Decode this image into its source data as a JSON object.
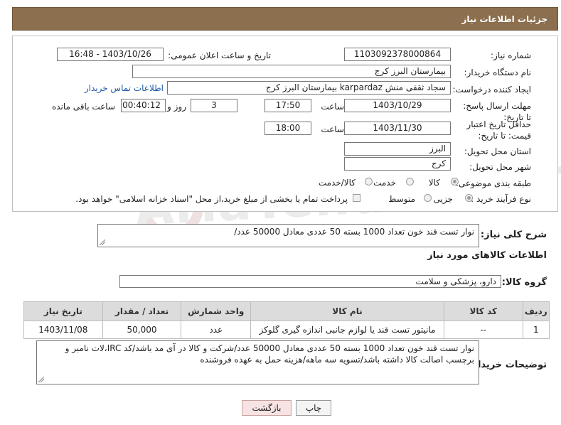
{
  "header": {
    "title": "جزئیات اطلاعات نیاز"
  },
  "need_number": {
    "label": "شماره نیاز:",
    "value": "1103092378000864"
  },
  "announce_datetime": {
    "label": "تاریخ و ساعت اعلان عمومی:",
    "value": "1403/10/26 - 16:48"
  },
  "buyer_org": {
    "label": "نام دستگاه خریدار:",
    "value": "بیمارستان البرز کرج"
  },
  "requester": {
    "label": "ایجاد کننده درخواست:",
    "value": "سجاد ثقفی منش karpardaz بیمارستان البرز کرج",
    "contact_link": "اطلاعات تماس خریدار"
  },
  "response_deadline": {
    "label": "مهلت ارسال پاسخ: تا تاریخ:",
    "date": "1403/10/29",
    "time_label": "ساعت",
    "time": "17:50",
    "days": "3",
    "days_label": "روز و",
    "remaining": "00:40:12",
    "remaining_label": "ساعت باقی مانده"
  },
  "price_validity": {
    "label": "حداقل تاریخ اعتبار قیمت: تا تاریخ:",
    "date": "1403/11/30",
    "time_label": "ساعت",
    "time": "18:00"
  },
  "delivery_province": {
    "label": "استان محل تحویل:",
    "value": "البرز"
  },
  "delivery_city": {
    "label": "شهر محل تحویل:",
    "value": "کرج"
  },
  "category": {
    "label": "طبقه بندی موضوعی:",
    "options": [
      "کالا",
      "خدمت",
      "کالا/خدمت"
    ],
    "selected": "کالا"
  },
  "purchase_type": {
    "label": "نوع فرآیند خرید :",
    "options": [
      "جزیی",
      "متوسط"
    ],
    "selected": "جزیی",
    "payment_note": "پرداخت تمام یا بخشی از مبلغ خرید،از محل \"اسناد خزانه اسلامی\" خواهد بود."
  },
  "general_description": {
    "label": "شرح کلی نیاز:",
    "value": "نوار تست قند خون تعداد 1000 بسته 50 عددی معادل 50000 عدد/"
  },
  "goods_info_title": "اطلاعات کالاهای مورد نیاز",
  "goods_group": {
    "label": "گروه کالا:",
    "value": "دارو، پزشکی و سلامت"
  },
  "table": {
    "headers": [
      "ردیف",
      "کد کالا",
      "نام کالا",
      "واحد شمارش",
      "تعداد / مقدار",
      "تاریخ نیاز"
    ],
    "rows": [
      [
        "1",
        "--",
        "مانیتور تست قند یا لوازم جانبی اندازه گیری گلوکز",
        "عدد",
        "50,000",
        "1403/11/08"
      ]
    ]
  },
  "buyer_notes": {
    "label": "توضیحات خریدار:",
    "value": "نوار تست قند خون تعداد 1000 بسته 50 عددی معادل 50000 عدد/شرکت و کالا در آی مد باشد/کد IRC،لات نامبر و برچسب اصالت کالا داشته باشد/تسویه سه ماهه/هزینه حمل به عهده فروشنده"
  },
  "buttons": {
    "print": "چاپ",
    "back": "بازگشت"
  },
  "watermark": "AriaTender.neT",
  "colors": {
    "header_bg": "#8b6f4e",
    "link": "#1a5aa8",
    "back_button_bg": "#f7e3e3"
  }
}
